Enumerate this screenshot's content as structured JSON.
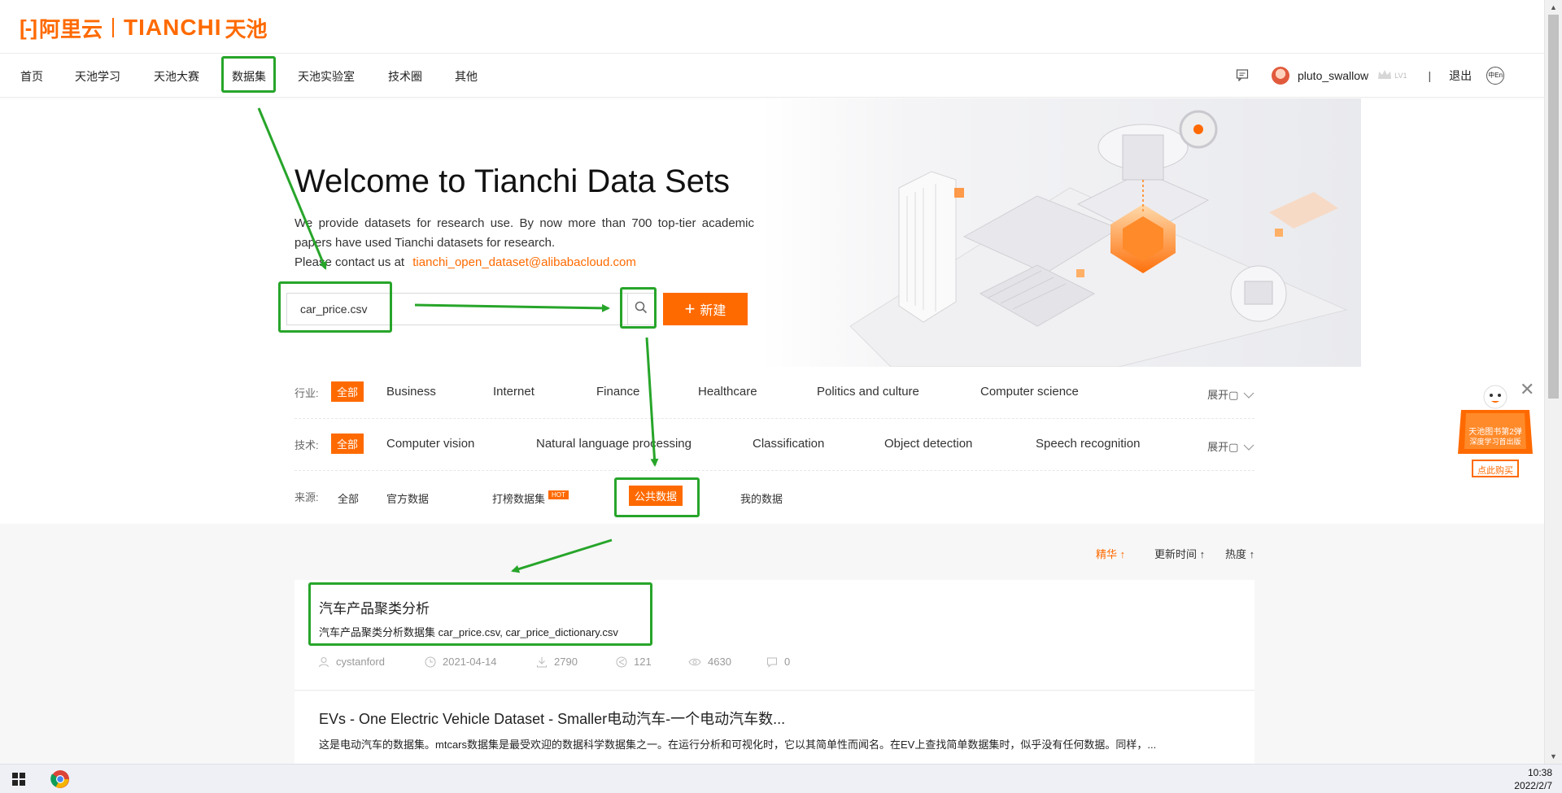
{
  "brand": {
    "mark": "[-]",
    "cn_name": "阿里云",
    "en_name": "TIANCHI",
    "cn_name2": "天池"
  },
  "nav": {
    "items": [
      "首页",
      "天池学习",
      "天池大赛",
      "数据集",
      "天池实验室",
      "技术圈",
      "其他"
    ],
    "username": "pluto_swallow",
    "level": "LV1",
    "divider": "|",
    "logout": "退出",
    "lang": "中En"
  },
  "hero": {
    "title": "Welcome to Tianchi Data Sets",
    "desc_line1": "We provide datasets for research use. By now more than 700 top-tier academic papers have used Tianchi datasets for research.",
    "desc_contact": "Please contact us at",
    "email": "tianchi_open_dataset@alibabacloud.com",
    "search_value": "car_price.csv",
    "new_label": "新建",
    "new_plus": "+"
  },
  "filters": {
    "industry": {
      "label": "行业:",
      "all": "全部",
      "options": [
        "Business",
        "Internet",
        "Finance",
        "Healthcare",
        "Politics and culture",
        "Computer science"
      ],
      "expand": "展开▢"
    },
    "tech": {
      "label": "技术:",
      "all": "全部",
      "options": [
        "Computer vision",
        "Natural language processing",
        "Classification",
        "Object detection",
        "Speech recognition"
      ],
      "expand": "展开▢"
    },
    "source": {
      "label": "来源:",
      "options": [
        "全部",
        "官方数据",
        "打榜数据集",
        "公共数据",
        "我的数据"
      ],
      "hot": "HOT"
    }
  },
  "sort": {
    "featured": "精华 ↑",
    "updated": "更新时间 ↑",
    "popular": "热度 ↑"
  },
  "results": [
    {
      "title": "汽车产品聚类分析",
      "desc": "汽车产品聚类分析数据集 car_price.csv, car_price_dictionary.csv",
      "author": "cystanford",
      "date": "2021-04-14",
      "downloads": "2790",
      "shares": "121",
      "views": "4630",
      "comments": "0"
    },
    {
      "title": "EVs - One Electric Vehicle Dataset - Smaller电动汽车-一个电动汽车数...",
      "desc": "这是电动汽车的数据集。mtcars数据集是最受欢迎的数据科学数据集之一。在运行分析和可视化时，它以其简单性而闻名。在EV上查找简单数据集时，似乎没有任何数据。同样，..."
    }
  ],
  "promo": {
    "line1": "天池图书第2弹",
    "line2": "深度学习首出版",
    "button": "点此购买",
    "close": "✕"
  },
  "taskbar": {
    "time": "10:38",
    "date": "2022/2/7"
  },
  "colors": {
    "accent": "#ff6a00",
    "annotation": "#27a52a"
  }
}
